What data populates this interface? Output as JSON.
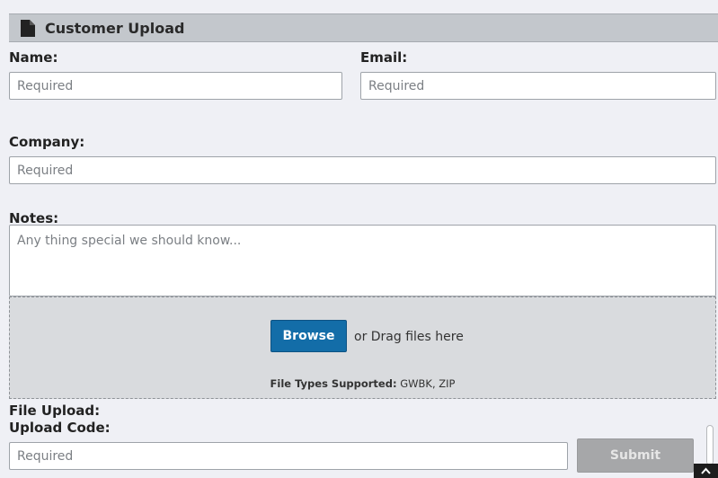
{
  "header": {
    "title": "Customer Upload",
    "icon": "file-icon"
  },
  "form": {
    "name": {
      "label": "Name:",
      "placeholder": "Required",
      "value": ""
    },
    "email": {
      "label": "Email:",
      "placeholder": "Required",
      "value": ""
    },
    "company": {
      "label": "Company:",
      "placeholder": "Required",
      "value": ""
    },
    "notes": {
      "label": "Notes:",
      "placeholder": "Any thing special we should know...",
      "value": ""
    },
    "dropzone": {
      "browse_label": "Browse",
      "drag_text": "or Drag files here",
      "types_label": "File Types Supported:",
      "types_value": "GWBK, ZIP"
    },
    "file_upload": {
      "label": "File Upload:"
    },
    "upload_code": {
      "label": "Upload Code:",
      "placeholder": "Required",
      "value": ""
    },
    "submit_label": "Submit",
    "submit_enabled": false
  },
  "colors": {
    "accent": "#136da8",
    "header_bg": "#c3c7cc",
    "page_bg": "#eff0f5",
    "dropzone_bg": "#d9dbde",
    "submit_disabled": "#a6a7a9"
  },
  "icons": [
    "file-icon",
    "chevron-up-icon"
  ]
}
